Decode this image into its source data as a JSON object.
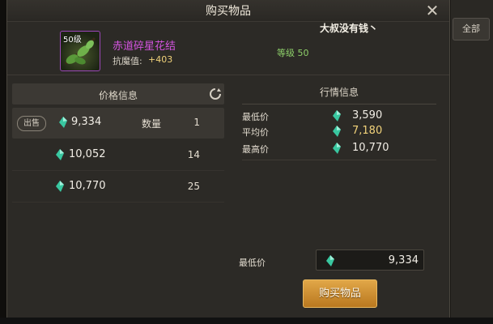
{
  "window": {
    "title": "购买物品",
    "seller_name": "大叔没有钱丶"
  },
  "side_tab": {
    "label": "全部"
  },
  "item": {
    "level_badge": "50级",
    "name": "赤道碎星花结",
    "stat_label": "抗魔值:",
    "stat_value": "+403",
    "grade": "等级 50",
    "name_color": "#d454e0"
  },
  "price_info": {
    "header": "价格信息",
    "sell_badge": "出售",
    "qty_label": "数量",
    "rows": [
      {
        "price": "9,334",
        "qty": "1"
      },
      {
        "price": "10,052",
        "qty": "14"
      },
      {
        "price": "10,770",
        "qty": "25"
      }
    ]
  },
  "market_info": {
    "header": "行情信息",
    "rows": [
      {
        "label": "最低价",
        "value": "3,590"
      },
      {
        "label": "平均价",
        "value": "7,180"
      },
      {
        "label": "最高价",
        "value": "10,770"
      }
    ],
    "avg_color": "#f1d27a"
  },
  "purchase": {
    "price_label": "最低价",
    "price_value": "9,334",
    "buy_button": "购买物品",
    "button_color": "#d69a3a"
  },
  "icons": {
    "currency": "gem-icon",
    "refresh": "refresh-icon",
    "close": "close-icon"
  }
}
